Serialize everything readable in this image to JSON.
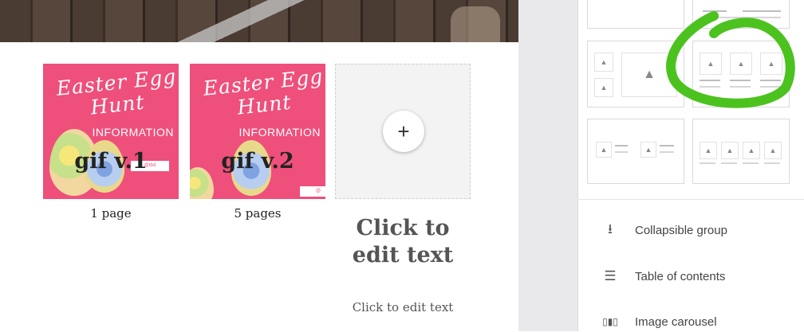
{
  "cards": [
    {
      "title": "gif v.1",
      "subtitle": "1 page",
      "thumb": {
        "script_line1": "Easter Egg",
        "script_line2": "Hunt",
        "info": "INFORMATION",
        "tag": "@tbd"
      }
    },
    {
      "title": "gif v.2",
      "subtitle": "5 pages",
      "thumb": {
        "script_line1": "Easter Egg",
        "script_line2": "Hunt",
        "info": "INFORMATION",
        "tag": "@"
      }
    }
  ],
  "add_card": {
    "plus": "+",
    "title": "Click to edit text",
    "subtitle": "Click to edit text"
  },
  "components": [
    {
      "icon": "collapsible-group-icon",
      "glyph": "⭳",
      "label": "Collapsible group"
    },
    {
      "icon": "table-of-contents-icon",
      "glyph": "☰",
      "label": "Table of contents"
    },
    {
      "icon": "image-carousel-icon",
      "glyph": "▯▮▯",
      "label": "Image carousel"
    }
  ],
  "colors": {
    "thumb_bg": "#ef4f7b",
    "annotation": "#4cc21f",
    "gutter": "#e9e9eb"
  }
}
